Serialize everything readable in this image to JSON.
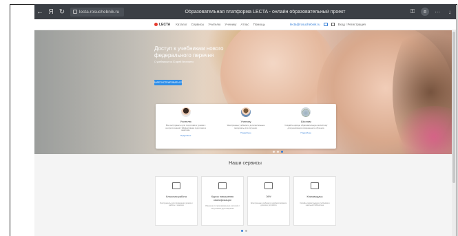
{
  "browser": {
    "url": "lecta.rosuchebnik.ru",
    "tab_title": "Образовательная платформа LECTA - онлайн образовательный проект"
  },
  "site": {
    "logo_text": "LECTA",
    "nav_links": [
      "Каталог",
      "Сервисы",
      "Учителю",
      "Ученику",
      "Атлас",
      "Помощь"
    ],
    "nav_account": "lecta@rosuchebnik.ru",
    "nav_login": "Вход / Регистрация"
  },
  "hero": {
    "title": "Доступ к учебникам нового федерального перечня",
    "subtitle": "С учебником на 30 дней бесплатно",
    "button_label": "ЗАРЕГИСТРИРОВАТЬСЯ"
  },
  "cards": [
    {
      "title": "Учителю",
      "text": "Все инструменты для подготовки к урокам и контроля знаний. Эффективная подготовка к занятиям.",
      "link": "Подробнее"
    },
    {
      "title": "Ученику",
      "text": "Электронные учебники и дополнительные материалы для изучения.",
      "link": "Подробнее"
    },
    {
      "title": "Школам",
      "text": "Создайте единую образовательную экосистему для реализации современного обучения.",
      "link": "Подробнее"
    }
  ],
  "services": {
    "title": "Наши сервисы",
    "items": [
      {
        "title": "Классная работа",
        "text": "Инструменты для проведения уроков и работы с классом"
      },
      {
        "title": "Курсы повышения квалификации",
        "text": "Обучение по программам для учителей с получением удостоверения"
      },
      {
        "title": "ЭФУ",
        "text": "Электронные учебники в удобном формате для всех устройств"
      },
      {
        "title": "Книгавыдача",
        "text": "Онлайн-сервис выдачи учебников в школьной библиотеке"
      }
    ]
  },
  "side_widget": "≡",
  "colors": {
    "accent": "#2f7bd6",
    "hero_button": "#2f8ee8",
    "logo_red": "#e63b2e",
    "browser_bar": "#3b3f45"
  }
}
